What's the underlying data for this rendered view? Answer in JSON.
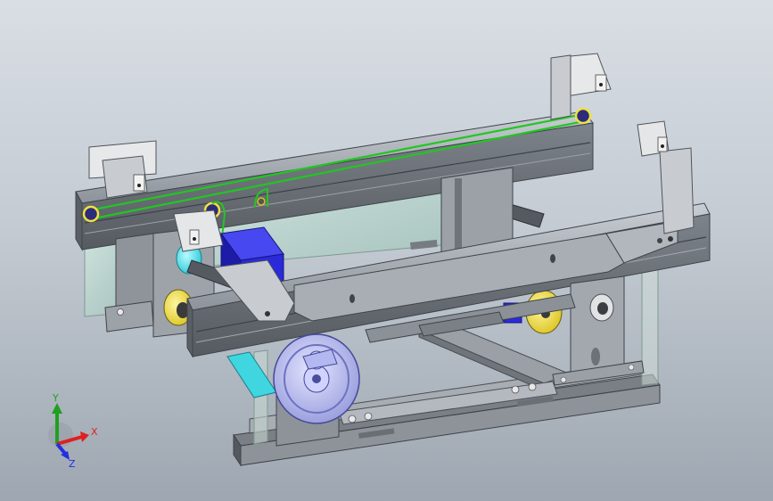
{
  "viewport": {
    "background_top": "#d9dee4",
    "background_bottom": "#9ea7b1"
  },
  "triad": {
    "x_label": "X",
    "y_label": "Y",
    "z_label": "Z",
    "x_color": "#e02020",
    "y_color": "#20a020",
    "z_color": "#2030e0"
  },
  "colors": {
    "frame_gray": "#a4a9b0",
    "frame_dark": "#6e737a",
    "belt_green": "#22c622",
    "motor_blue": "#2a2ad8",
    "roller_cyan": "#38e0e8",
    "pulley_yellow": "#f4e23a",
    "handwheel_lavender": "#b9bef0",
    "glass_tint": "#b7d6cf"
  }
}
